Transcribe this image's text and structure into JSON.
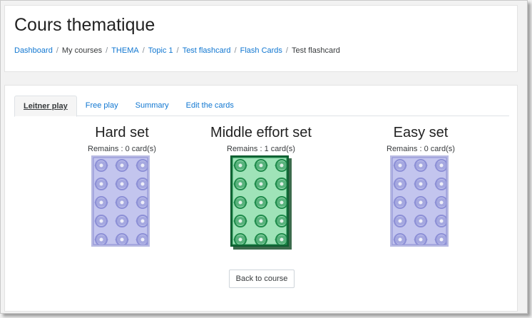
{
  "page": {
    "title": "Cours thematique"
  },
  "breadcrumb": [
    {
      "label": "Dashboard",
      "link": true
    },
    {
      "label": "My courses",
      "link": false
    },
    {
      "label": "THEMA",
      "link": true
    },
    {
      "label": "Topic 1",
      "link": true
    },
    {
      "label": "Test flashcard",
      "link": true
    },
    {
      "label": "Flash Cards",
      "link": true
    },
    {
      "label": "Test flashcard",
      "link": false
    }
  ],
  "tabs": [
    {
      "label": "Leitner play",
      "active": true
    },
    {
      "label": "Free play",
      "active": false
    },
    {
      "label": "Summary",
      "active": false
    },
    {
      "label": "Edit the cards",
      "active": false
    }
  ],
  "decks": [
    {
      "title": "Hard set",
      "remains": "Remains : 0 card(s)",
      "style": "empty",
      "color": "#8c8fd6"
    },
    {
      "title": "Middle effort set",
      "remains": "Remains : 1 card(s)",
      "style": "active",
      "color": "#1e8a4a"
    },
    {
      "title": "Easy set",
      "remains": "Remains : 0 card(s)",
      "style": "empty",
      "color": "#8c8fd6"
    }
  ],
  "buttons": {
    "back": "Back to course"
  },
  "colors": {
    "link": "#1177d1",
    "text": "#373a3c",
    "active_card": "#1e8a4a",
    "empty_card": "#8c8fd6"
  }
}
